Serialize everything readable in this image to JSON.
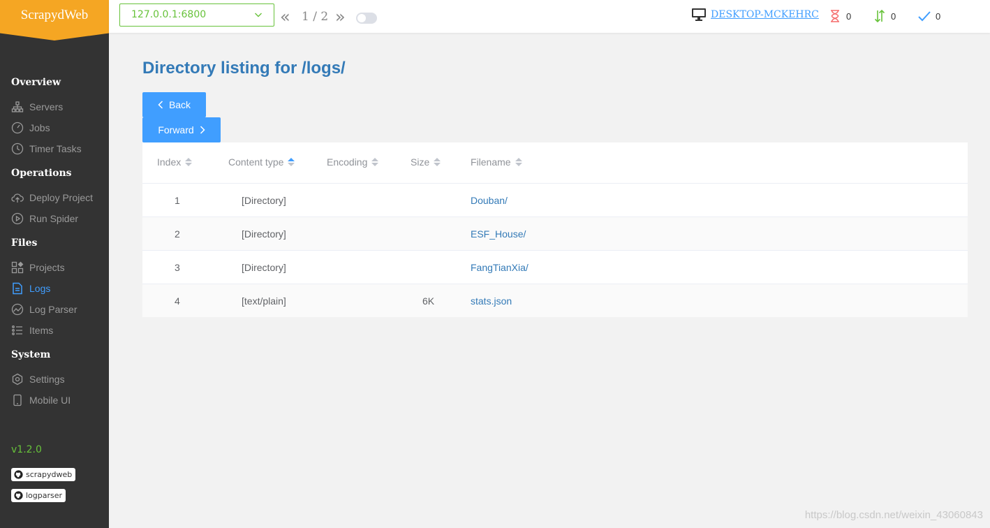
{
  "app": {
    "title": "ScrapydWeb",
    "version": "v1.2.0"
  },
  "sidebar": {
    "sections": [
      {
        "title": "Overview",
        "items": [
          {
            "label": "Servers",
            "icon": "sitemap-icon"
          },
          {
            "label": "Jobs",
            "icon": "dashboard-icon"
          },
          {
            "label": "Timer Tasks",
            "icon": "timer-icon"
          }
        ]
      },
      {
        "title": "Operations",
        "items": [
          {
            "label": "Deploy Project",
            "icon": "upload-cloud-icon"
          },
          {
            "label": "Run Spider",
            "icon": "play-circle-icon"
          }
        ]
      },
      {
        "title": "Files",
        "items": [
          {
            "label": "Projects",
            "icon": "grid-icon"
          },
          {
            "label": "Logs",
            "icon": "document-icon",
            "active": true
          },
          {
            "label": "Log Parser",
            "icon": "chart-icon"
          },
          {
            "label": "Items",
            "icon": "list-icon"
          }
        ]
      },
      {
        "title": "System",
        "items": [
          {
            "label": "Settings",
            "icon": "gear-icon"
          },
          {
            "label": "Mobile UI",
            "icon": "mobile-icon"
          }
        ]
      }
    ],
    "badges": [
      "scrapydweb",
      "logparser"
    ]
  },
  "topbar": {
    "server": "127.0.0.1:6800",
    "pager": "1 / 2",
    "prev_glyph": "«",
    "next_glyph": "»",
    "host": "DESKTOP-MCKEHRC",
    "stats": {
      "pending": "0",
      "running": "0",
      "finished": "0"
    }
  },
  "main": {
    "title": "Directory listing for /logs/",
    "back_label": "Back",
    "forward_label": "Forward",
    "table": {
      "columns": [
        "Index",
        "Content type",
        "Encoding",
        "Size",
        "Filename"
      ],
      "rows": [
        {
          "index": "1",
          "type": "[Directory]",
          "encoding": "",
          "size": "",
          "filename": "Douban/"
        },
        {
          "index": "2",
          "type": "[Directory]",
          "encoding": "",
          "size": "",
          "filename": "ESF_House/"
        },
        {
          "index": "3",
          "type": "[Directory]",
          "encoding": "",
          "size": "",
          "filename": "FangTianXia/"
        },
        {
          "index": "4",
          "type": "[text/plain]",
          "encoding": "",
          "size": "6K",
          "filename": "stats.json"
        }
      ]
    }
  },
  "watermark": "https://blog.csdn.net/weixin_43060843",
  "colors": {
    "accent": "#409eff",
    "brand": "#f5a623",
    "sidebar": "#333333",
    "success": "#67c23a",
    "danger": "#f56c6c"
  }
}
